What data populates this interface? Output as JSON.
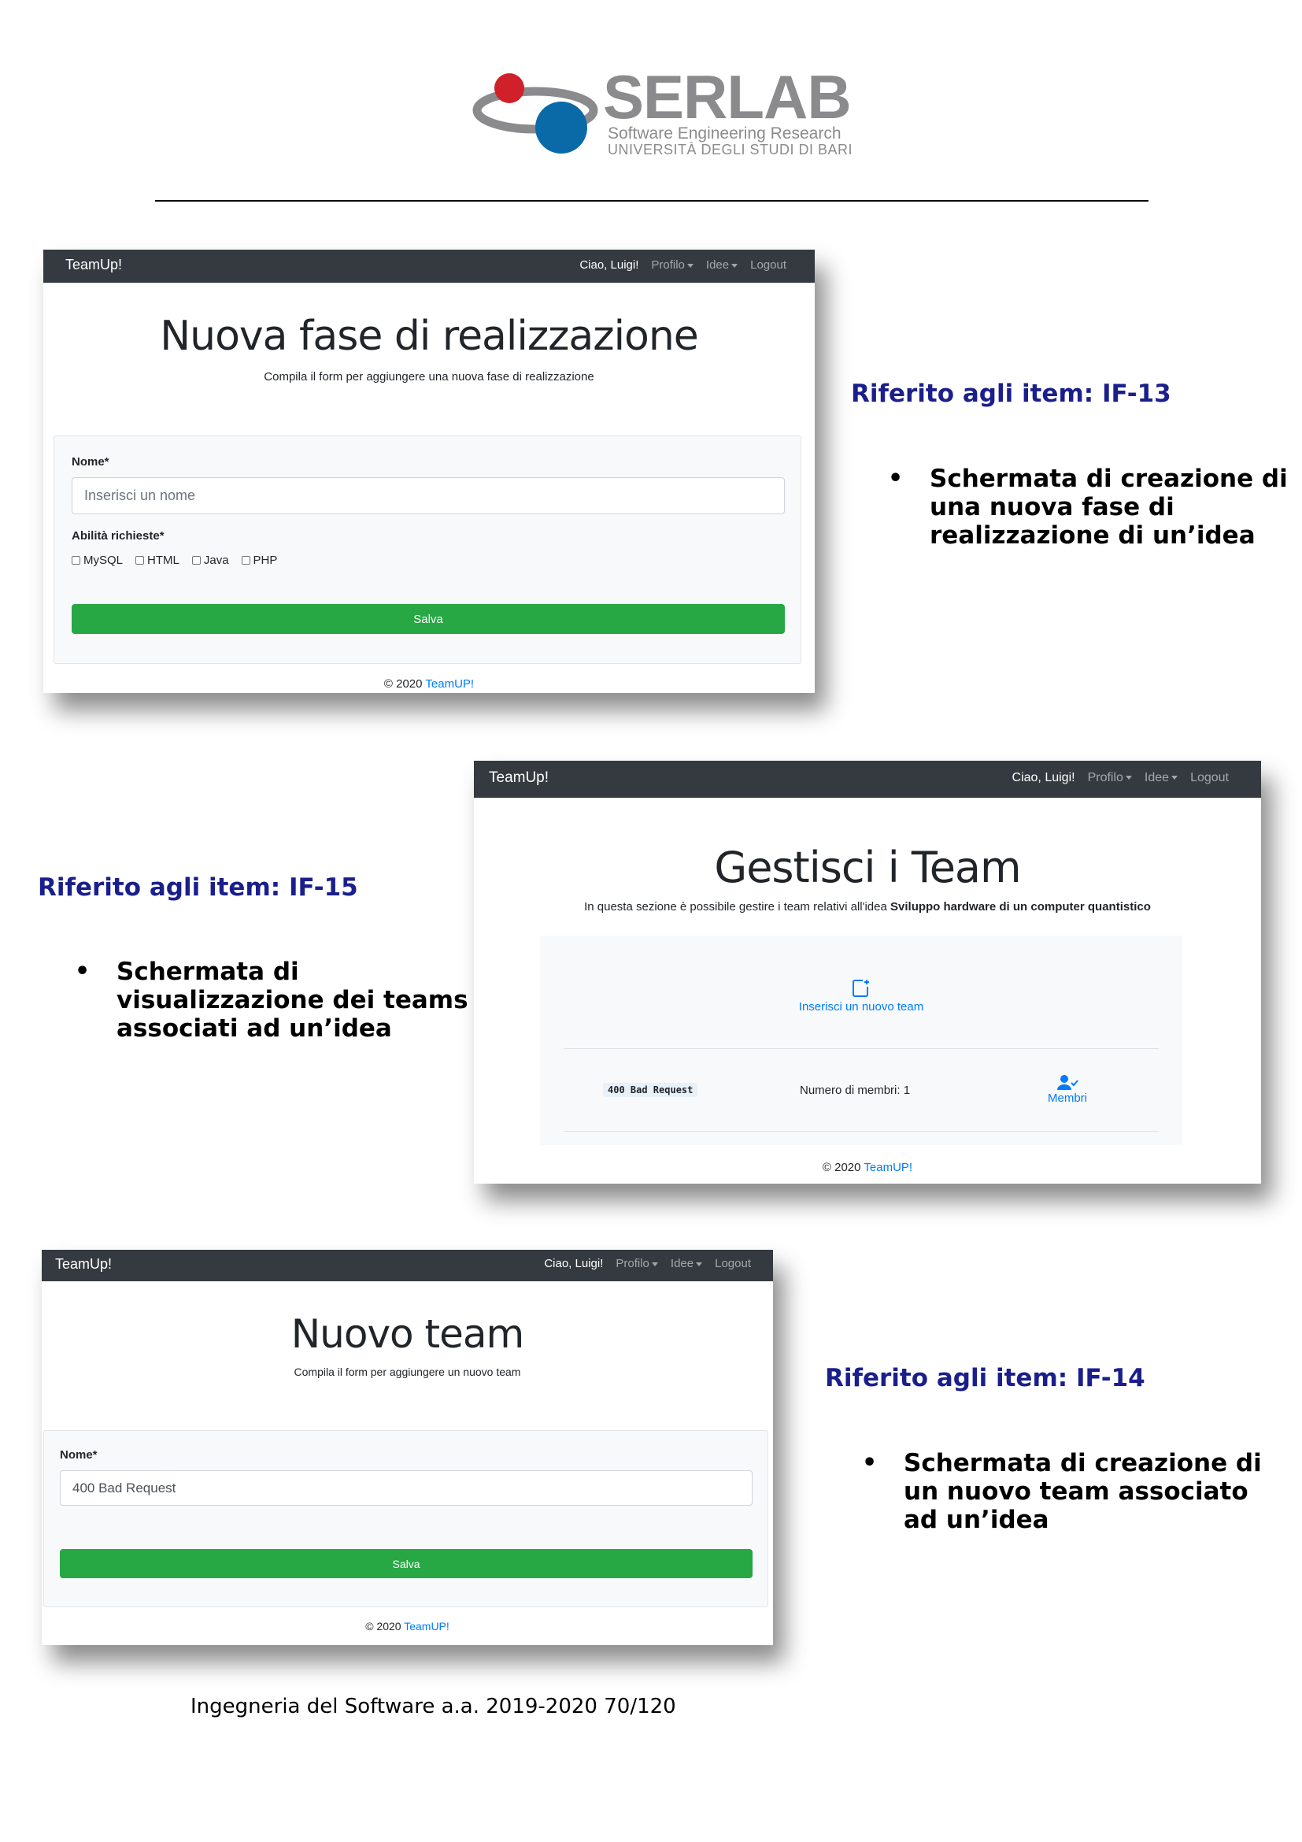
{
  "logo": {
    "name": "SERLAB",
    "line1": "Software Engineering Research",
    "line2": "UNIVERSITÀ DEGLI STUDI DI BARI",
    "colors": {
      "red": "#d0202a",
      "blue": "#0a6aa8",
      "gray": "#8b8b8d"
    }
  },
  "nav": {
    "brand": "TeamUp!",
    "user": "Ciao, Luigi!",
    "profile": "Profilo",
    "ideas": "Idee",
    "logout": "Logout"
  },
  "shot1": {
    "title": "Nuova fase di realizzazione",
    "subtitle": "Compila il form per aggiungere una nuova fase di realizzazione",
    "name_label": "Nome*",
    "name_placeholder": "Inserisci un nome",
    "skills_label": "Abilità richieste*",
    "skills": [
      "MySQL",
      "HTML",
      "Java",
      "PHP"
    ],
    "save": "Salva",
    "footer_prefix": "© 2020",
    "footer_link": "TeamUP!"
  },
  "shot2": {
    "title": "Gestisci i Team",
    "subtitle_prefix": "In questa sezione è possibile gestire i team relativi all'idea",
    "subtitle_idea": "Sviluppo hardware di un computer quantistico",
    "insert_team": "Inserisci un nuovo team",
    "team_name": "400 Bad Request",
    "members_count": "Numero di membri: 1",
    "members": "Membri",
    "footer_prefix": "© 2020",
    "footer_link": "TeamUP!"
  },
  "shot3": {
    "title": "Nuovo team",
    "subtitle": "Compila il form per aggiungere un nuovo team",
    "name_label": "Nome*",
    "name_value": "400 Bad Request",
    "save": "Salva",
    "footer_prefix": "© 2020",
    "footer_link": "TeamUP!"
  },
  "captions": {
    "c1": {
      "ref": "Riferito agli item: IF-13",
      "bullet": [
        "Schermata di creazione di",
        "una nuova fase di",
        "realizzazione di un’idea"
      ]
    },
    "c2": {
      "ref": "Riferito agli item: IF-15",
      "bullet": [
        "Schermata di",
        "visualizzazione dei teams",
        "associati ad un’idea"
      ]
    },
    "c3": {
      "ref": "Riferito agli item: IF-14",
      "bullet": [
        "Schermata di creazione di",
        "un nuovo team associato",
        "ad un’idea"
      ]
    }
  },
  "page_footer": "Ingegneria del Software a.a. 2019-2020 70/120"
}
